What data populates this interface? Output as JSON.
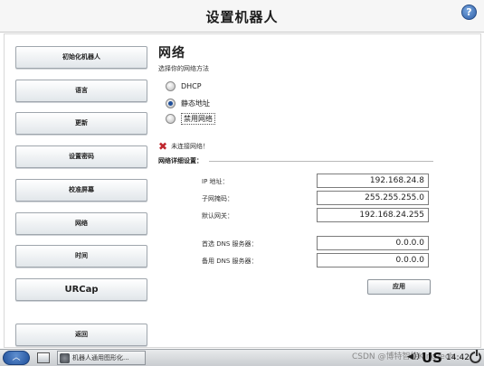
{
  "header": {
    "title": "设置机器人",
    "help_icon": "help-icon"
  },
  "nav": [
    {
      "label": "初始化机器人"
    },
    {
      "label": "语言"
    },
    {
      "label": "更新"
    },
    {
      "label": "设置密码"
    },
    {
      "label": "校准屏幕"
    },
    {
      "label": "网络"
    },
    {
      "label": "时间"
    },
    {
      "label": "URCap"
    },
    {
      "label": "返回"
    }
  ],
  "network": {
    "title": "网络",
    "subtitle": "选择你的网络方法",
    "options": [
      {
        "label": "DHCP",
        "selected": false
      },
      {
        "label": "静态地址",
        "selected": true
      },
      {
        "label": "禁用网络",
        "selected": false
      }
    ],
    "status_text": "未连接网络！",
    "details_label": "网络详细设置：",
    "fields": [
      {
        "label": "IP 地址：",
        "value": "192.168.24.8"
      },
      {
        "label": "子网掩码：",
        "value": "255.255.255.0"
      },
      {
        "label": "默认网关：",
        "value": "192.168.24.255"
      },
      {
        "label": "首选 DNS 服务器：",
        "value": "0.0.0.0"
      },
      {
        "label": "备用 DNS 服务器：",
        "value": "0.0.0.0"
      }
    ],
    "apply_label": "应用"
  },
  "taskbar": {
    "task_label": "机器人通用图形化...",
    "watermark": "CSDN @博特智能KingTech",
    "keyboard_layout": "US",
    "clock": "14:42",
    "icons": [
      "start-icon",
      "desktop-icon",
      "speaker-icon",
      "power-icon"
    ]
  },
  "colors": {
    "accent": "#1f4f9a",
    "error": "#c0262d"
  }
}
